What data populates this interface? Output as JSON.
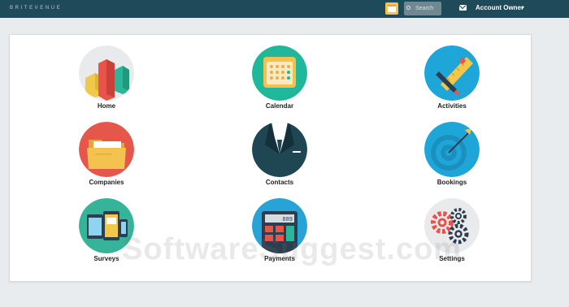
{
  "header": {
    "brand": "BRITEVENUE",
    "search_label": "Search",
    "account_label": "Account Owner",
    "calendar_icon": "calendar-icon",
    "mail_icon": "mail-icon"
  },
  "tiles": [
    {
      "label": "Home",
      "icon": "bar-chart-icon",
      "color": "#e8e9ea"
    },
    {
      "label": "Calendar",
      "icon": "calendar-icon",
      "color": "#1fb89a"
    },
    {
      "label": "Activities",
      "icon": "ruler-pencil-icon",
      "color": "#1ea6d9"
    },
    {
      "label": "Companies",
      "icon": "folder-icon",
      "color": "#e5574a"
    },
    {
      "label": "Contacts",
      "icon": "suit-icon",
      "color": "#1f4653"
    },
    {
      "label": "Bookings",
      "icon": "target-icon",
      "color": "#1ea6d9"
    },
    {
      "label": "Surveys",
      "icon": "devices-icon",
      "color": "#35b49a"
    },
    {
      "label": "Payments",
      "icon": "calculator-icon",
      "color": "#27a3d6"
    },
    {
      "label": "Settings",
      "icon": "gears-icon",
      "color": "#e8e9ea"
    }
  ],
  "calculator_display": "889",
  "watermark": "SoftwareSuggest.com"
}
